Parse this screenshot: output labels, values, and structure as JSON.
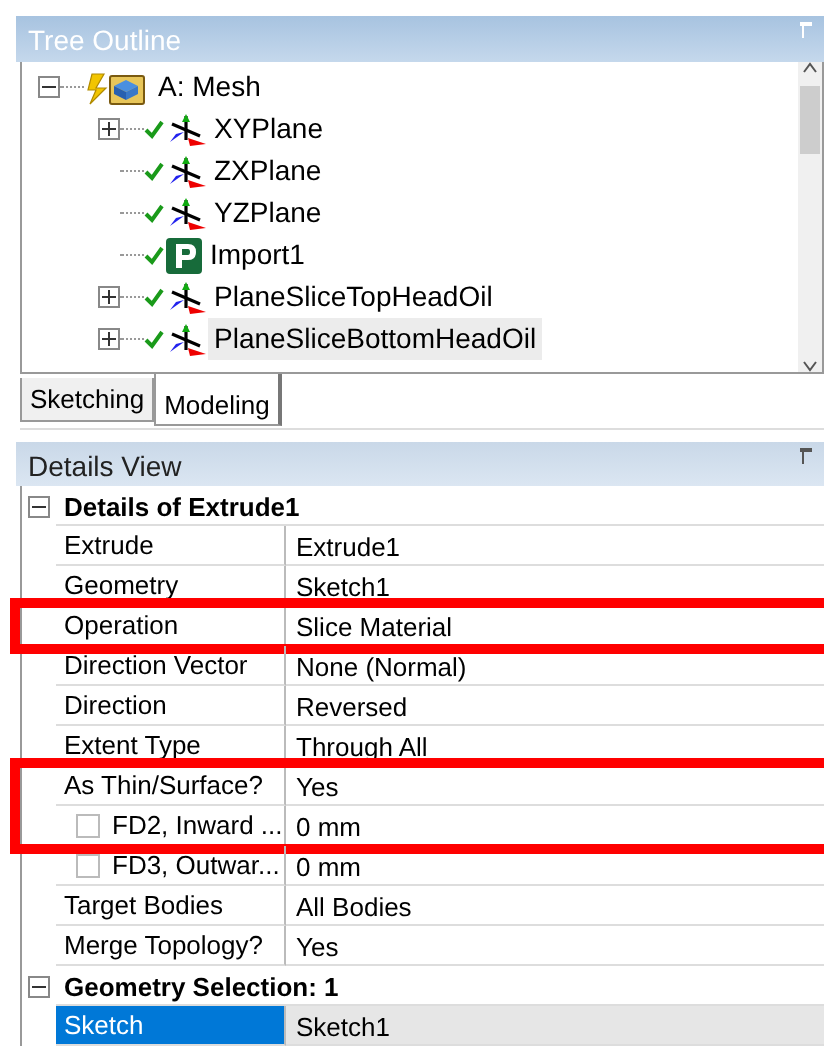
{
  "tree_outline": {
    "title": "Tree Outline",
    "items": [
      {
        "label": "A: Mesh",
        "kind": "mesh",
        "expanded": true,
        "selected": false,
        "children": [
          {
            "label": "XYPlane",
            "kind": "plane",
            "valid": true,
            "expanded": false,
            "selected": false
          },
          {
            "label": "ZXPlane",
            "kind": "plane",
            "valid": true,
            "selected": false
          },
          {
            "label": "YZPlane",
            "kind": "plane",
            "valid": true,
            "selected": false
          },
          {
            "label": "Import1",
            "kind": "import",
            "valid": true,
            "selected": false
          },
          {
            "label": "PlaneSliceTopHeadOil",
            "kind": "plane",
            "valid": true,
            "expanded": false,
            "selected": false
          },
          {
            "label": "PlaneSliceBottomHeadOil",
            "kind": "plane",
            "valid": true,
            "expanded": false,
            "selected": true
          }
        ]
      }
    ]
  },
  "tabs": [
    {
      "label": "Sketching",
      "selected": false
    },
    {
      "label": "Modeling",
      "selected": true
    }
  ],
  "details_view": {
    "title": "Details View",
    "rows": [
      {
        "kind": "group",
        "label": "Details of Extrude1",
        "expanded": true
      },
      {
        "kind": "property",
        "label": "Extrude",
        "value": "Extrude1",
        "highlighted": false,
        "selected": false
      },
      {
        "kind": "property",
        "label": "Geometry",
        "value": "Sketch1",
        "highlighted": false,
        "selected": false
      },
      {
        "kind": "property",
        "label": "Operation",
        "value": "Slice Material",
        "highlighted": true,
        "selected": false
      },
      {
        "kind": "property",
        "label": "Direction Vector",
        "value": "None (Normal)",
        "highlighted": false,
        "selected": false
      },
      {
        "kind": "property",
        "label": "Direction",
        "value": "Reversed",
        "highlighted": false,
        "selected": false
      },
      {
        "kind": "property",
        "label": "Extent Type",
        "value": "Through All",
        "highlighted": false,
        "selected": false
      },
      {
        "kind": "property",
        "label": "As Thin/Surface?",
        "value": "Yes",
        "highlighted": true,
        "selected": false
      },
      {
        "kind": "checkbox",
        "label": "FD2,  Inward ...",
        "value": "0 mm",
        "checked": false,
        "highlighted": true,
        "selected": false
      },
      {
        "kind": "checkbox",
        "label": "FD3,  Outwar...",
        "value": "0 mm",
        "checked": false,
        "highlighted": false,
        "selected": false
      },
      {
        "kind": "property",
        "label": "Target Bodies",
        "value": "All Bodies",
        "highlighted": false,
        "selected": false
      },
      {
        "kind": "property",
        "label": "Merge Topology?",
        "value": "Yes",
        "highlighted": false,
        "selected": false
      },
      {
        "kind": "group",
        "label": "Geometry Selection: 1",
        "expanded": true
      },
      {
        "kind": "property",
        "label": "Sketch",
        "value": "Sketch1",
        "highlighted": false,
        "selected": true
      }
    ]
  }
}
